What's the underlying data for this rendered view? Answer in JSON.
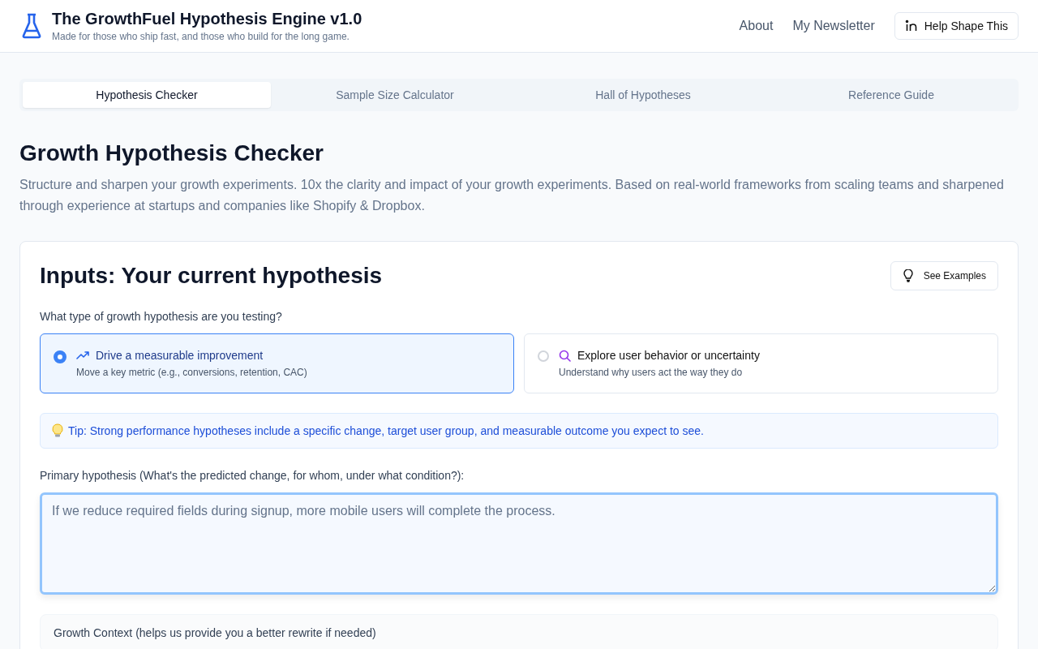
{
  "header": {
    "title": "The GrowthFuel Hypothesis Engine v1.0",
    "subtitle": "Made for those who ship fast, and those who build for the long game.",
    "nav": [
      "About",
      "My Newsletter"
    ],
    "cta": "Help Shape This"
  },
  "tabs": [
    {
      "label": "Hypothesis Checker",
      "selected": true
    },
    {
      "label": "Sample Size Calculator",
      "selected": false
    },
    {
      "label": "Hall of Hypotheses",
      "selected": false
    },
    {
      "label": "Reference Guide",
      "selected": false
    }
  ],
  "page": {
    "title": "Growth Hypothesis Checker",
    "description": "Structure and sharpen your growth experiments. 10x the clarity and impact of your growth experiments. Based on real-world frameworks from scaling teams and sharpened through experience at startups and companies like Shopify & Dropbox."
  },
  "card": {
    "title": "Inputs: Your current hypothesis",
    "examples_button": "See Examples",
    "type_question": "What type of growth hypothesis are you testing?",
    "types": [
      {
        "kind": "trend",
        "label": "Drive a measurable improvement",
        "description": "Move a key metric (e.g., conversions, retention, CAC)",
        "selected": true
      },
      {
        "kind": "search",
        "label": "Explore user behavior or uncertainty",
        "description": "Understand why users act the way they do",
        "selected": false
      }
    ],
    "tip": "Tip: Strong performance hypotheses include a specific change, target user group, and measurable outcome you expect to see.",
    "hypothesis_label": "Primary hypothesis (What's the predicted change, for whom, under what condition?):",
    "hypothesis_placeholder": "If we reduce required fields during signup, more mobile users will complete the process.",
    "context_title": "Growth Context (helps us provide you a better rewrite if needed)"
  }
}
